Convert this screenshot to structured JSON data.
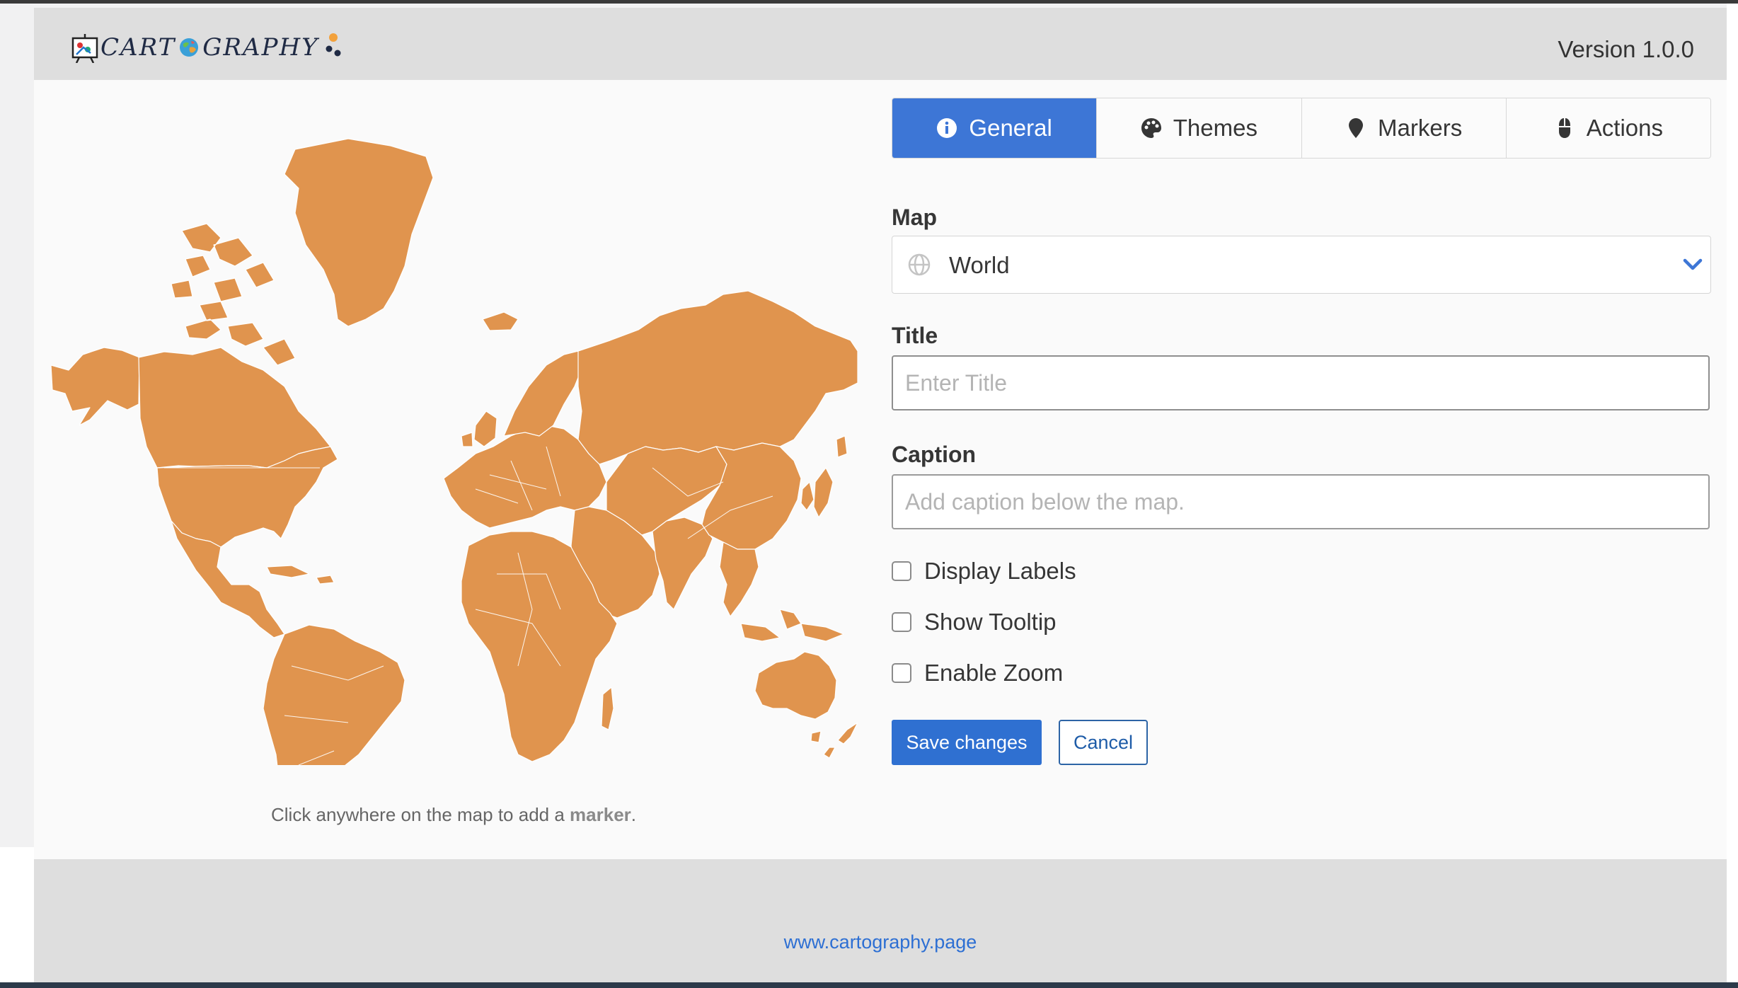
{
  "header": {
    "logo_text_left": "CART",
    "logo_text_right": "GRAPHY",
    "version": "Version 1.0.0"
  },
  "tabs": [
    {
      "label": "General",
      "icon": "info-circle-icon",
      "active": true
    },
    {
      "label": "Themes",
      "icon": "palette-icon",
      "active": false
    },
    {
      "label": "Markers",
      "icon": "map-pin-icon",
      "active": false
    },
    {
      "label": "Actions",
      "icon": "mouse-icon",
      "active": false
    }
  ],
  "form": {
    "map_label": "Map",
    "map_value": "World",
    "title_label": "Title",
    "title_placeholder": "Enter Title",
    "title_value": "",
    "caption_label": "Caption",
    "caption_placeholder": "Add caption below the map.",
    "caption_value": "",
    "checkboxes": [
      {
        "label": "Display Labels",
        "checked": false
      },
      {
        "label": "Show Tooltip",
        "checked": false
      },
      {
        "label": "Enable Zoom",
        "checked": false
      }
    ],
    "save_label": "Save changes",
    "cancel_label": "Cancel"
  },
  "map": {
    "hint_prefix": "Click anywhere on the map to add a ",
    "hint_strong": "marker",
    "hint_suffix": ".",
    "fill_color": "#e0944e"
  },
  "footer": {
    "link_text": "www.cartography.page"
  },
  "colors": {
    "accent": "#3d76d6",
    "header_bg": "#dedede",
    "map_fill": "#e0944e"
  }
}
